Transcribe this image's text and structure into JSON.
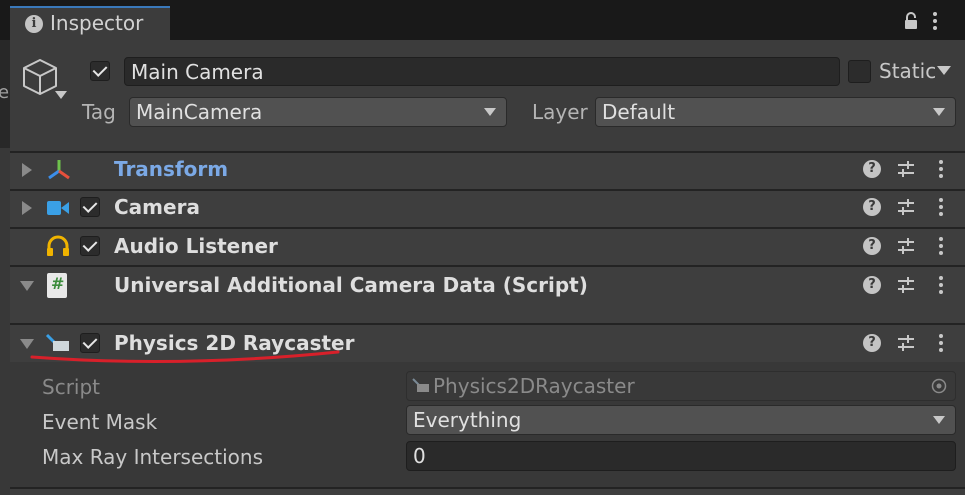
{
  "tab": {
    "title": "Inspector"
  },
  "left_strip": {
    "char": "e"
  },
  "gameobject": {
    "name": "Main Camera",
    "active": true,
    "static_label": "Static",
    "static": false,
    "tag_label": "Tag",
    "tag_value": "MainCamera",
    "layer_label": "Layer",
    "layer_value": "Default"
  },
  "components": [
    {
      "title": "Transform",
      "icon": "transform-icon",
      "expanded": false,
      "has_checkbox": false,
      "title_color": "#7ba9e6"
    },
    {
      "title": "Camera",
      "icon": "camera-icon",
      "expanded": false,
      "has_checkbox": true,
      "enabled": true
    },
    {
      "title": "Audio Listener",
      "icon": "headphones-icon",
      "expanded": false,
      "has_checkbox": true,
      "enabled": true
    },
    {
      "title": "Universal Additional Camera Data (Script)",
      "icon": "csharp-script-icon",
      "expanded": true,
      "has_checkbox": false,
      "script_glyph": "#"
    },
    {
      "title": "Physics 2D Raycaster",
      "icon": "raycaster-icon",
      "expanded": true,
      "has_checkbox": true,
      "enabled": true
    }
  ],
  "raycaster_props": {
    "script_label": "Script",
    "script_value": "Physics2DRaycaster",
    "event_mask_label": "Event Mask",
    "event_mask_value": "Everything",
    "max_ray_label": "Max Ray Intersections",
    "max_ray_value": "0"
  },
  "colors": {
    "tab_accent": "#3a79bb",
    "transform_title": "#7ba9e6",
    "annotation_underline": "#d8202a"
  }
}
